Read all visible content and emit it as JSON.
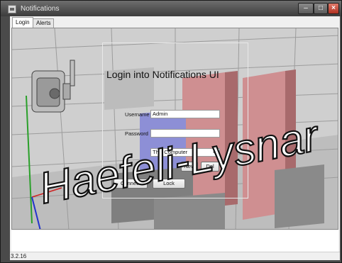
{
  "window": {
    "title": "Notifications"
  },
  "tabs": [
    {
      "label": "Login"
    },
    {
      "label": "Alerts"
    }
  ],
  "login": {
    "title": "Login into Notifications UI",
    "username_label": "Username",
    "username_value": "Admin",
    "password_label": "Password",
    "server_selected": "This Computer",
    "new_button": "New",
    "del_button": "Del",
    "connect_button": "Connect",
    "lock_button": "Lock"
  },
  "watermark": {
    "text": "Haefeli-Lysnar"
  },
  "status": {
    "version": "3.2.16"
  },
  "colors": {
    "wall_red": "#cf8f91",
    "wall_blue": "#8d8fd6",
    "axis_green": "#2aa02a",
    "axis_red": "#cc2222",
    "axis_blue": "#2233cc"
  }
}
